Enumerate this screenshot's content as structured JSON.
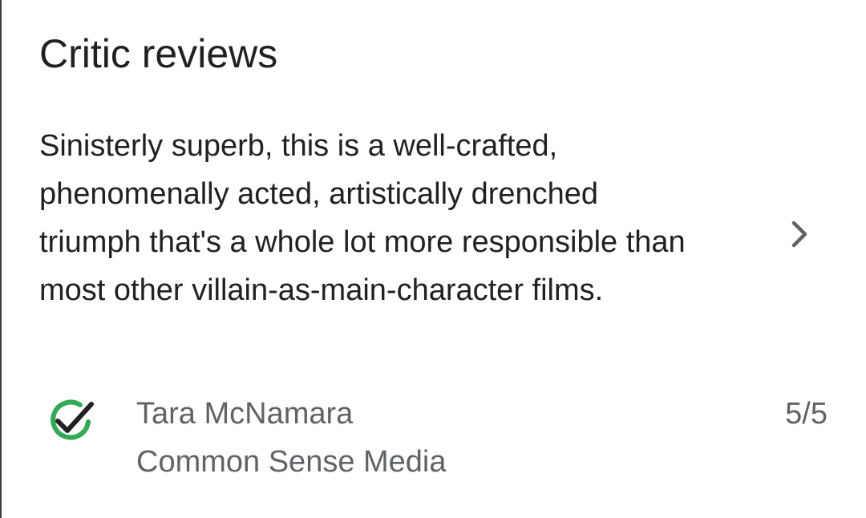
{
  "section": {
    "title": "Critic reviews"
  },
  "review": {
    "text": "Sinisterly superb, this is a well-crafted, phenomenally acted, artistically drenched triumph that's a whole lot more responsible than most other villain-as-main-character films.",
    "open_icon": "chevron-right-icon",
    "critic_name": "Tara McNamara",
    "publication": "Common Sense Media",
    "score": "5/5",
    "publication_icon": "check-circle-icon",
    "colors": {
      "check_ring": "#34a853",
      "check_mark": "#202124",
      "secondary_text": "#5f6368",
      "primary_text": "#202124"
    }
  }
}
